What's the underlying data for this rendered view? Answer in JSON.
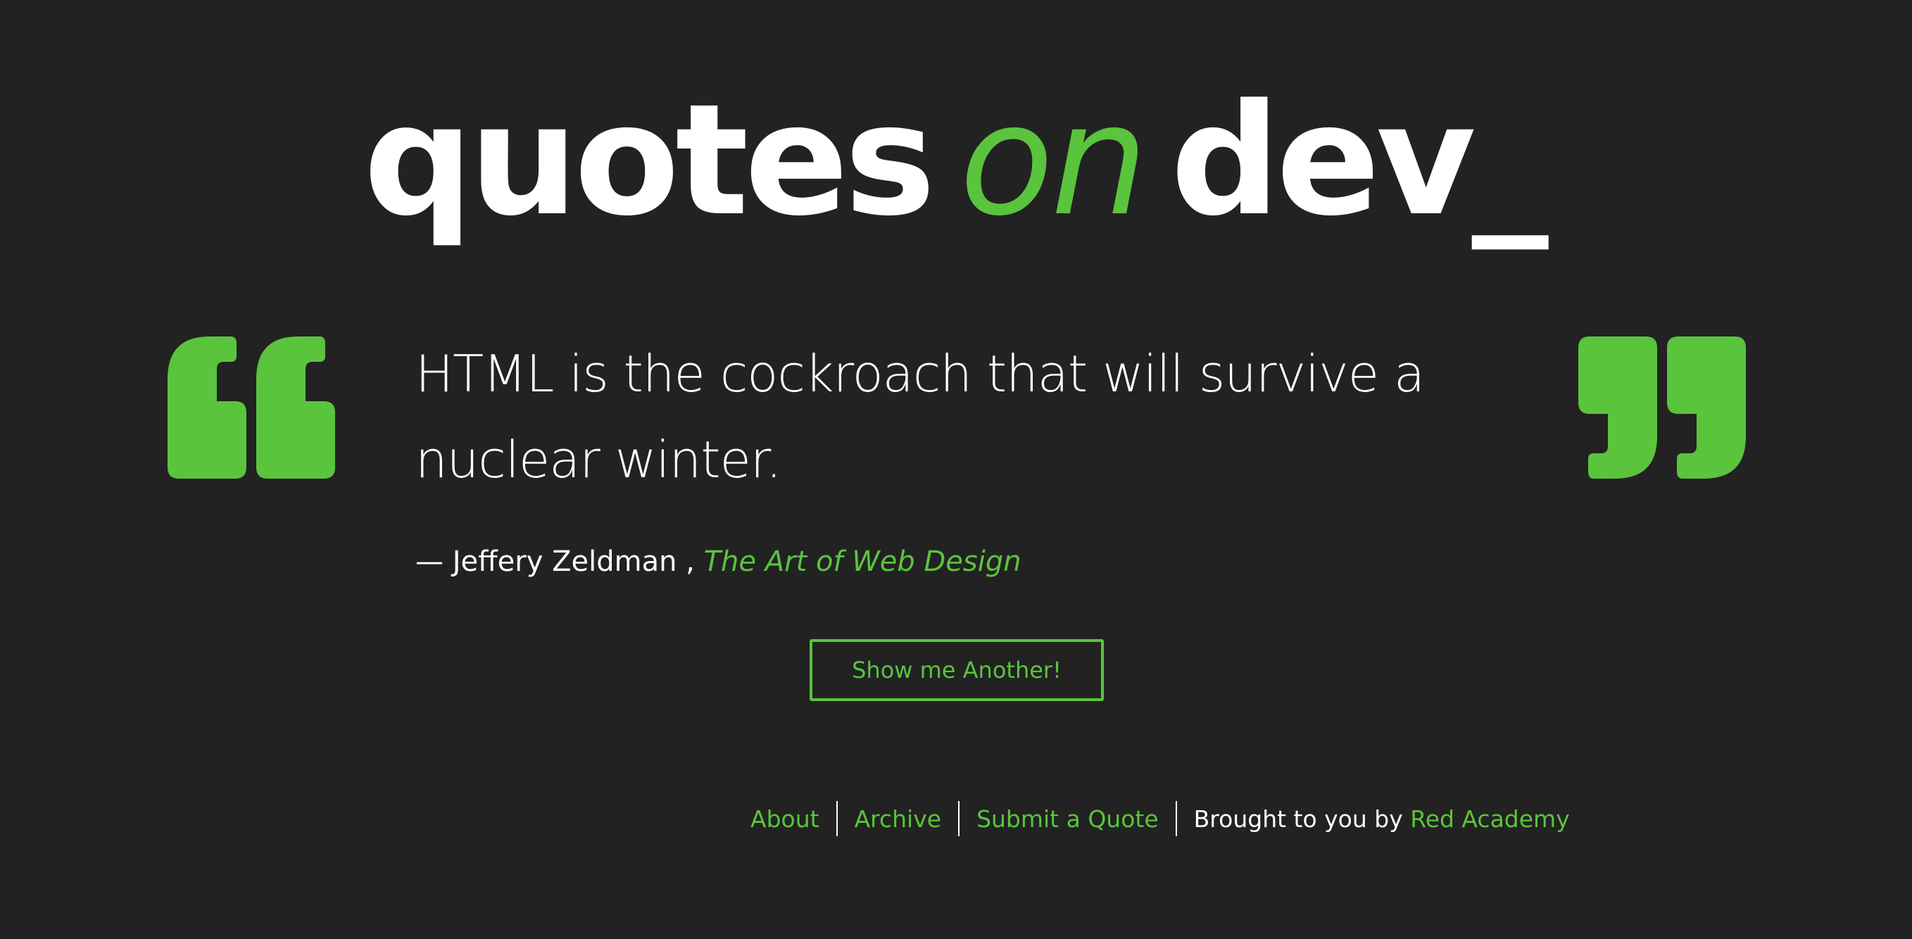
{
  "logo": {
    "word1": "quotes",
    "word2": "on",
    "word3": "dev",
    "cursor": "_"
  },
  "quote": {
    "text": "HTML is the cockroach that will survive a nuclear winter.",
    "dash": "— ",
    "author": "Jeffery Zeldman",
    "separator": " , ",
    "source": "The Art of Web Design"
  },
  "button": {
    "label": "Show me Another!"
  },
  "footer": {
    "links": [
      "About",
      "Archive",
      "Submit a Quote"
    ],
    "credit_prefix": "Brought to you by ",
    "credit_link": "Red Academy"
  },
  "icons": {
    "open_quote": "open-quote-icon",
    "close_quote": "close-quote-icon"
  },
  "colors": {
    "background": "#222222",
    "accent": "#5ac43d",
    "text": "#ffffff"
  }
}
